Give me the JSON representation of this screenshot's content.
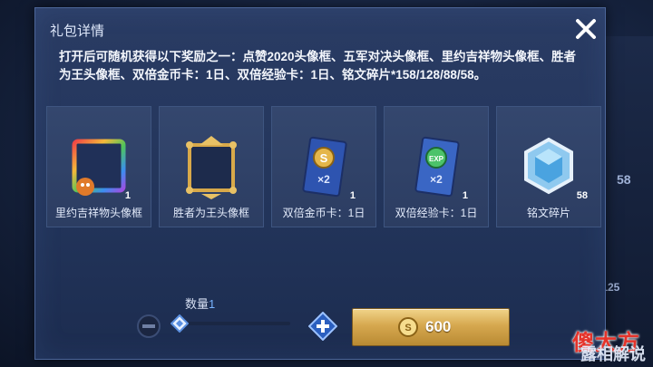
{
  "background": {
    "right_numbers": [
      "58",
      "/125"
    ]
  },
  "watermark": {
    "text": "傻大方",
    "sub_text": "露相解说"
  },
  "dialog": {
    "title": "礼包详情",
    "description": "打开后可随机获得以下奖励之一：点赞2020头像框、五军对决头像框、里约吉祥物头像框、胜者为王头像框、双倍金币卡：1日、双倍经验卡：1日、铭文碎片*158/128/88/58。"
  },
  "items": [
    {
      "name": "里约吉祥物头像框",
      "qty": "1",
      "icon": "mascot-avatar-frame-icon"
    },
    {
      "name": "胜者为王头像框",
      "qty": "",
      "icon": "gold-avatar-frame-icon"
    },
    {
      "name": "双倍金币卡：1日",
      "qty": "1",
      "icon": "double-coin-card-icon",
      "badge": "×2"
    },
    {
      "name": "双倍经验卡：1日",
      "qty": "1",
      "icon": "double-exp-card-icon",
      "badge": "×2",
      "exp_text": "EXP"
    },
    {
      "name": "铭文碎片",
      "qty": "58",
      "icon": "inscription-shard-icon"
    }
  ],
  "quantity": {
    "label": "数量",
    "value": "1"
  },
  "buy": {
    "price": "600",
    "coin_letter": "S"
  },
  "colors": {
    "accent_blue": "#78b4ff",
    "gold": "#d6a84f",
    "panel": "#22345a"
  }
}
